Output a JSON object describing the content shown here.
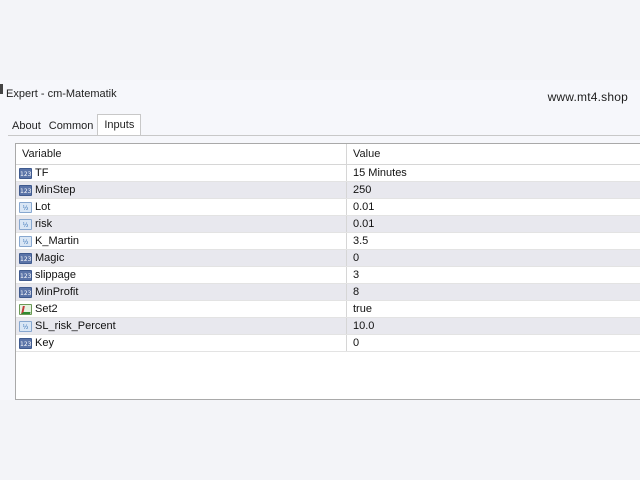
{
  "window": {
    "title": "Expert - cm-Matematik"
  },
  "watermark": "www.mt4.shop",
  "tabs": [
    {
      "label": "About",
      "active": false
    },
    {
      "label": "Common",
      "active": false
    },
    {
      "label": "Inputs",
      "active": true
    }
  ],
  "table": {
    "headers": {
      "variable": "Variable",
      "value": "Value"
    },
    "rows": [
      {
        "name": "TF",
        "value": "15 Minutes",
        "type_icon": "enum-type-icon",
        "icon_text": "123"
      },
      {
        "name": "MinStep",
        "value": "250",
        "type_icon": "integer-type-icon",
        "icon_text": "123"
      },
      {
        "name": "Lot",
        "value": "0.01",
        "type_icon": "double-type-icon",
        "icon_text": "½"
      },
      {
        "name": "risk",
        "value": "0.01",
        "type_icon": "double-type-icon",
        "icon_text": "½"
      },
      {
        "name": "K_Martin",
        "value": "3.5",
        "type_icon": "double-type-icon",
        "icon_text": "½"
      },
      {
        "name": "Magic",
        "value": "0",
        "type_icon": "integer-type-icon",
        "icon_text": "123"
      },
      {
        "name": "slippage",
        "value": "3",
        "type_icon": "integer-type-icon",
        "icon_text": "123"
      },
      {
        "name": "MinProfit",
        "value": "8",
        "type_icon": "integer-type-icon",
        "icon_text": "123"
      },
      {
        "name": "Set2",
        "value": "true",
        "type_icon": "bool-type-icon",
        "icon_text": ""
      },
      {
        "name": "SL_risk_Percent",
        "value": "10.0",
        "type_icon": "double-type-icon",
        "icon_text": "½"
      },
      {
        "name": "Key",
        "value": "0",
        "type_icon": "integer-type-icon",
        "icon_text": "123"
      }
    ]
  }
}
